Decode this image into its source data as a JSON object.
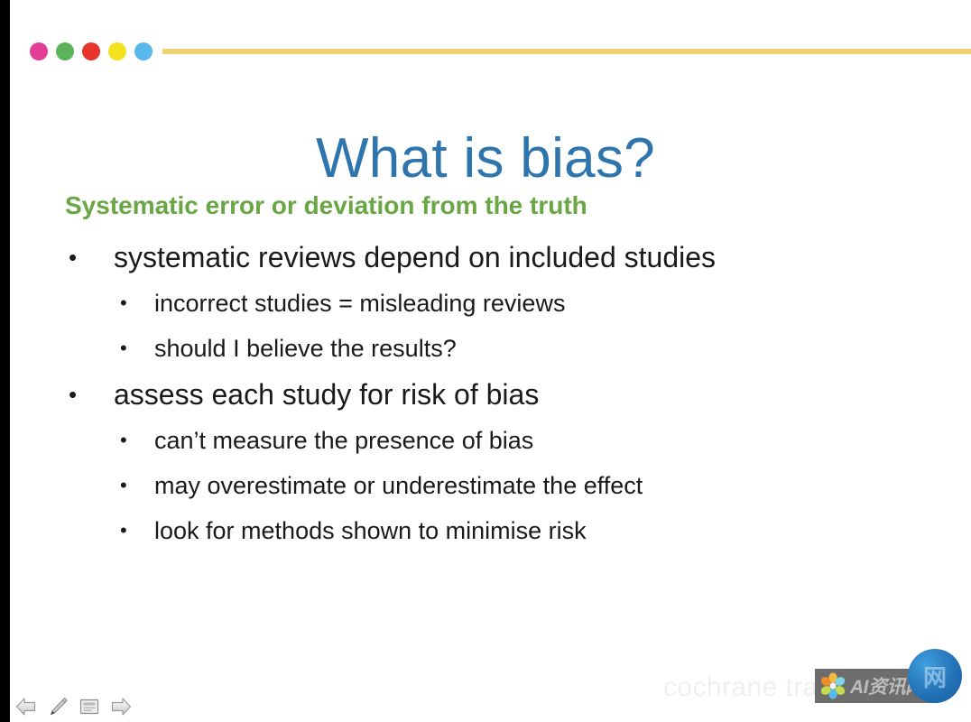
{
  "slide": {
    "title": "What is bias?",
    "subhead": "Systematic error or deviation from the truth",
    "title_color": "#2e74ad",
    "subhead_color": "#69a744",
    "body_color": "#1a1a1a",
    "background_color": "#ffffff",
    "bullets": [
      {
        "text": "systematic reviews depend on included studies",
        "marker": "•",
        "children": [
          {
            "text": "incorrect studies = misleading reviews",
            "marker": "•"
          },
          {
            "text": "should I believe the results?",
            "marker": "•"
          }
        ]
      },
      {
        "text": "assess each study for risk of bias",
        "marker": "•",
        "children": [
          {
            "text": "can’t measure the presence of bias",
            "marker": "•"
          },
          {
            "text": "may overestimate or underestimate the effect",
            "marker": "•"
          },
          {
            "text": "look for methods shown to minimise risk",
            "marker": "•"
          }
        ]
      }
    ]
  },
  "decoration": {
    "dots": [
      {
        "name": "dot-magenta",
        "color": "#e43d96"
      },
      {
        "name": "dot-green",
        "color": "#5cb35c"
      },
      {
        "name": "dot-red",
        "color": "#e8352b"
      },
      {
        "name": "dot-yellow",
        "color": "#f5e21f"
      },
      {
        "name": "dot-blue",
        "color": "#57b9ec"
      }
    ],
    "rule_color": "#ecd271"
  },
  "footer": {
    "brand": "cochrane training"
  },
  "watermark": {
    "text": "AI资讯网",
    "badge_glyph": "网",
    "bar_color": "#6d6d6d",
    "flower_colors": [
      "#f5b942",
      "#7fd3e8",
      "#c6dc4f",
      "#f2f2f2",
      "#f28c28",
      "#57b9ec"
    ]
  },
  "nav": {
    "buttons": [
      {
        "name": "previous-slide-button",
        "label": "Previous"
      },
      {
        "name": "pen-annotate-button",
        "label": "Pen"
      },
      {
        "name": "notes-button",
        "label": "Notes"
      },
      {
        "name": "next-slide-button",
        "label": "Next"
      }
    ]
  }
}
